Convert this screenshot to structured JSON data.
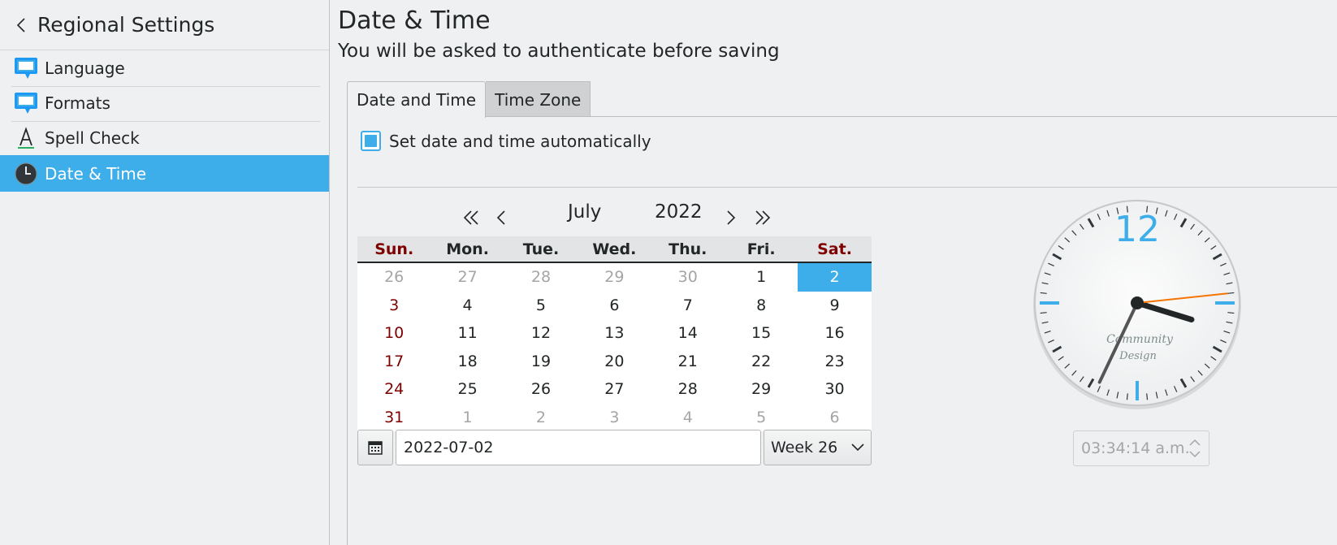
{
  "sidebar": {
    "title": "Regional Settings",
    "items": [
      {
        "label": "Language",
        "icon": "chat-bubble-icon"
      },
      {
        "label": "Formats",
        "icon": "chat-bubble-icon"
      },
      {
        "label": "Spell Check",
        "icon": "spellcheck-icon"
      },
      {
        "label": "Date & Time",
        "icon": "clock-icon",
        "active": true
      }
    ]
  },
  "main": {
    "title": "Date & Time",
    "subtitle": "You will be asked to authenticate before saving",
    "tabs": [
      {
        "label": "Date and Time",
        "active": true
      },
      {
        "label": "Time Zone",
        "active": false
      }
    ],
    "auto_label": "Set date and time automatically",
    "auto_checked": true
  },
  "calendar": {
    "month": "July",
    "year": "2022",
    "weekdays": [
      "Sun.",
      "Mon.",
      "Tue.",
      "Wed.",
      "Thu.",
      "Fri.",
      "Sat."
    ],
    "weeks": [
      [
        "26",
        "27",
        "28",
        "29",
        "30",
        "1",
        "2"
      ],
      [
        "3",
        "4",
        "5",
        "6",
        "7",
        "8",
        "9"
      ],
      [
        "10",
        "11",
        "12",
        "13",
        "14",
        "15",
        "16"
      ],
      [
        "17",
        "18",
        "19",
        "20",
        "21",
        "22",
        "23"
      ],
      [
        "24",
        "25",
        "26",
        "27",
        "28",
        "29",
        "30"
      ],
      [
        "31",
        "1",
        "2",
        "3",
        "4",
        "5",
        "6"
      ]
    ],
    "selected": "2",
    "date_value": "2022-07-02",
    "week_label": "Week 26"
  },
  "clock": {
    "face_number": "12",
    "brand_line1": "Community",
    "brand_line2": "Design",
    "time_value": "03:34:14 a.m.",
    "hours": 3,
    "minutes": 34,
    "seconds": 14,
    "accent_color": "#3daee9",
    "second_hand_color": "#f67400"
  },
  "colors": {
    "accent": "#3daee9",
    "weekend": "#7f0000",
    "background": "#eff0f1"
  }
}
